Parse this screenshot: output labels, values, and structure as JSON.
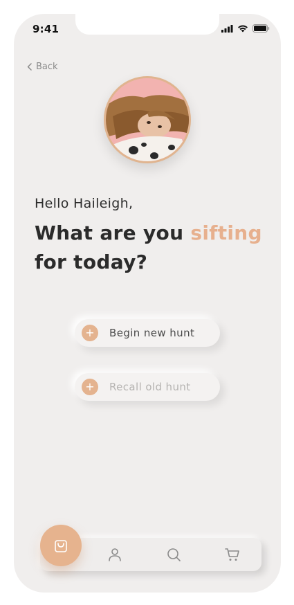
{
  "status_bar": {
    "time": "9:41",
    "icons": [
      "signal-icon",
      "wifi-icon",
      "battery-icon"
    ]
  },
  "nav": {
    "back_label": "Back",
    "back_icon": "chevron-left-icon"
  },
  "profile": {
    "avatar_icon": "profile-photo"
  },
  "greeting": {
    "hello": "Hello Haileigh,",
    "headline_part1": "What are you ",
    "headline_accent": "sifting",
    "headline_part2": "for today?"
  },
  "actions": [
    {
      "label": "Begin new hunt",
      "icon": "plus-icon"
    },
    {
      "label": "Recall old hunt",
      "icon": "plus-icon"
    }
  ],
  "tab_bar": {
    "items": [
      {
        "name": "bag",
        "icon": "shopping-bag-icon",
        "active": true
      },
      {
        "name": "profile",
        "icon": "user-icon",
        "active": false
      },
      {
        "name": "search",
        "icon": "search-icon",
        "active": false
      },
      {
        "name": "cart",
        "icon": "cart-icon",
        "active": false
      }
    ]
  },
  "colors": {
    "accent": "#e7b08e",
    "background": "#f0eeed",
    "text_dark": "#2b2b2b",
    "text_muted": "#b5b3b1"
  }
}
